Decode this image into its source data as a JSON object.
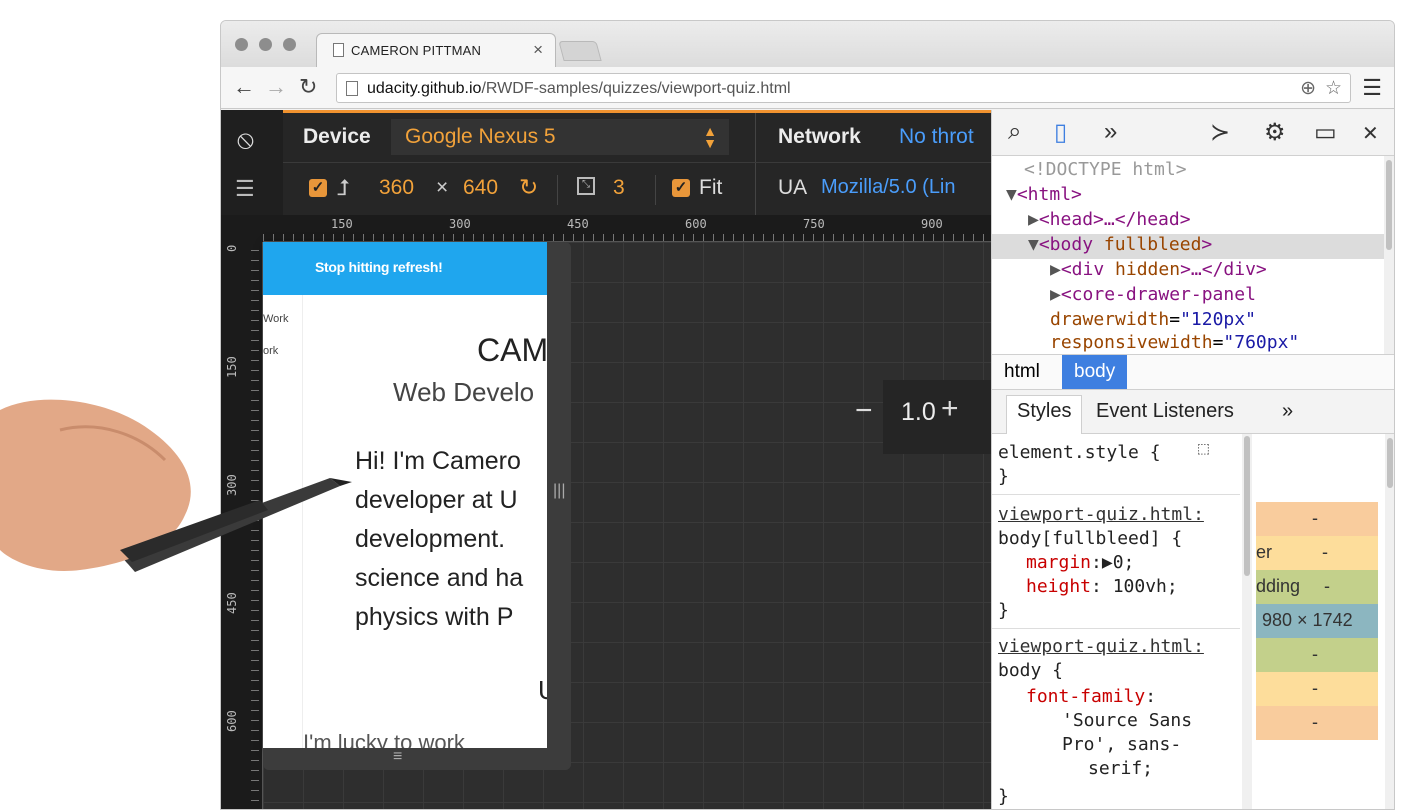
{
  "browser": {
    "tab_title": "CAMERON PITTMAN",
    "tab_close": "×",
    "url_host": "udacity.github.io",
    "url_path": "/RWDF-samples/quizzes/viewport-quiz.html"
  },
  "emulation": {
    "device_label": "Device",
    "device_value": "Google Nexus 5",
    "network_label": "Network",
    "network_value": "No throt",
    "width": "360",
    "times": "×",
    "height": "640",
    "pixel_ratio": "3",
    "fit_label": "Fit",
    "ua_label": "UA",
    "ua_value": "Mozilla/5.0 (Lin",
    "zoom": "1.0",
    "ruler_h_ticks": [
      "150",
      "300",
      "450",
      "600",
      "750",
      "900"
    ],
    "ruler_v_ticks": [
      "0",
      "150",
      "300",
      "450",
      "600"
    ]
  },
  "site": {
    "bar_text": "Stop hitting refresh!",
    "nav_items": [
      "Work",
      "ork"
    ],
    "name": "CAM",
    "role": "Web Develo",
    "paragraph": [
      "Hi! I'm Camero",
      "developer at U",
      "development.",
      "science and ha",
      "physics with P"
    ],
    "cut_heading": "U",
    "bottom_text": "I'm lucky to work"
  },
  "devtools": {
    "dom_lines": {
      "doctype": "<!DOCTYPE html>",
      "html_open": "<html>",
      "head": "<head>…</head>",
      "body_tag": "<body",
      "body_attr": "fullbleed",
      "body_close": ">",
      "div_tag": "<div",
      "div_attr": "hidden",
      "div_rest": ">…</div>",
      "panel_tag": "<core-drawer-panel",
      "drawer_attr": "drawerwidth",
      "drawer_val": "\"120px\"",
      "resp_attr": "responsivewidth",
      "resp_val": "\"760px\""
    },
    "breadcrumbs": [
      "html",
      "body"
    ],
    "subtabs": [
      "Styles",
      "Event Listeners"
    ],
    "styles": {
      "element_style": "element.style {",
      "close": "}",
      "rule1_src": "viewport-quiz.html:",
      "rule1_selector": "body[fullbleed] {",
      "rule1_p1_name": "margin",
      "rule1_p1_val": ":▶0;",
      "rule1_p2_name": "height",
      "rule1_p2_val": ": 100vh;",
      "rule2_src": "viewport-quiz.html:",
      "rule2_selector": "body {",
      "rule2_p1_name": "font-family",
      "rule2_p1_val": ":",
      "rule2_val_l1": "'Source Sans",
      "rule2_val_l2": "Pro', sans-",
      "rule2_val_l3": "serif;"
    },
    "metrics": {
      "dash": "-",
      "border_label": "er",
      "padding_label": "dding",
      "content_size": "980 × 1742"
    }
  }
}
